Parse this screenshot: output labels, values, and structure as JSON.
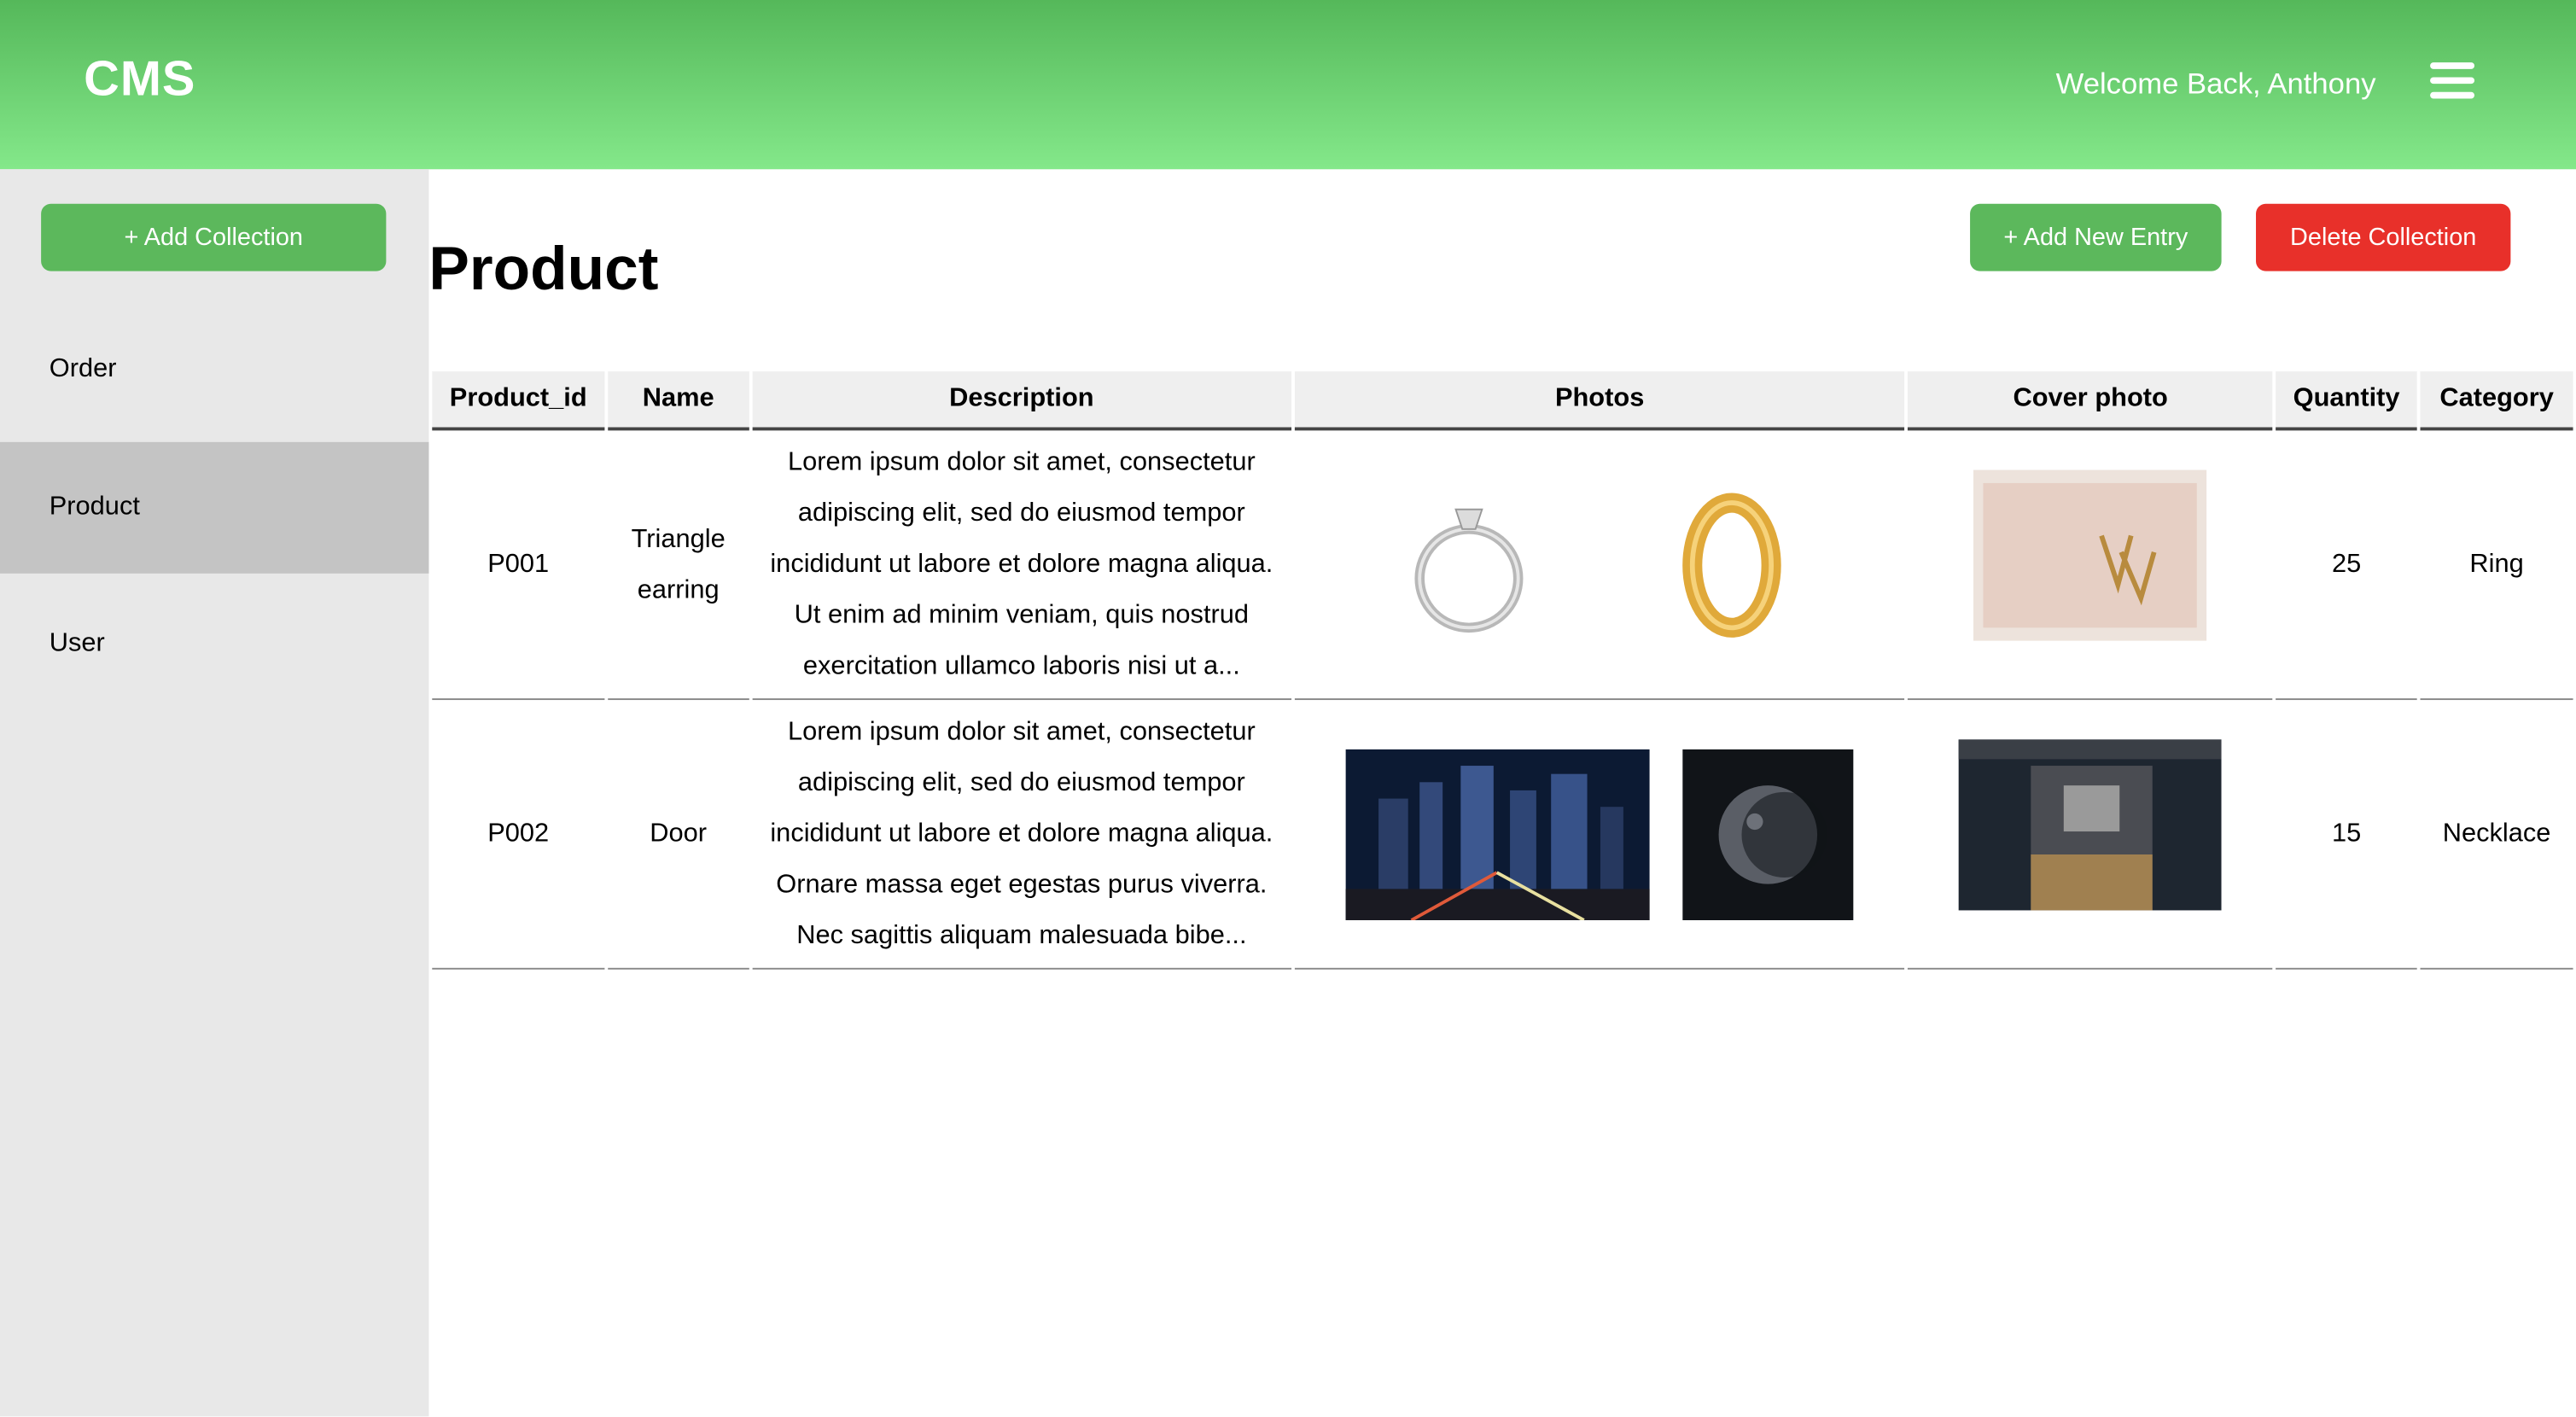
{
  "header": {
    "brand": "CMS",
    "welcome": "Welcome Back, Anthony"
  },
  "sidebar": {
    "add_collection_label": "+ Add Collection",
    "items": [
      {
        "label": "Order"
      },
      {
        "label": "Product",
        "active": true
      },
      {
        "label": "User"
      }
    ]
  },
  "main": {
    "title": "Product",
    "add_entry_label": "+ Add New Entry",
    "delete_collection_label": "Delete Collection"
  },
  "table": {
    "columns": [
      "Product_id",
      "Name",
      "Description",
      "Photos",
      "Cover photo",
      "Quantity",
      "Category"
    ],
    "rows": [
      {
        "product_id": "P001",
        "name": "Triangle earring",
        "description": "Lorem ipsum dolor sit amet, consectetur adipiscing elit, sed do eiusmod tempor incididunt ut labore et dolore magna aliqua. Ut enim ad minim veniam, quis nostrud exercitation ullamco laboris nisi ut a...",
        "photos": [
          "silver-diamond-ring-photo",
          "gold-band-ring-photo"
        ],
        "cover_photo": "gold-earring-on-card-photo",
        "quantity": "25",
        "category": "Ring"
      },
      {
        "product_id": "P002",
        "name": "Door",
        "description": "Lorem ipsum dolor sit amet, consectetur adipiscing elit, sed do eiusmod tempor incididunt ut labore et dolore magna aliqua. Ornare massa eget egestas purus viverra. Nec sagittis aliquam malesuada bibe...",
        "photos": [
          "night-city-skyline-photo",
          "moon-photo"
        ],
        "cover_photo": "desk-screenshot-photo",
        "quantity": "15",
        "category": "Necklace"
      }
    ]
  },
  "colors": {
    "header_gradient_top": "#55b85a",
    "header_gradient_bottom": "#84e88a",
    "primary_button": "#5cb85c",
    "danger_button": "#e8302a",
    "sidebar_bg": "#e8e8e8",
    "sidebar_active_bg": "#c4c4c4"
  }
}
